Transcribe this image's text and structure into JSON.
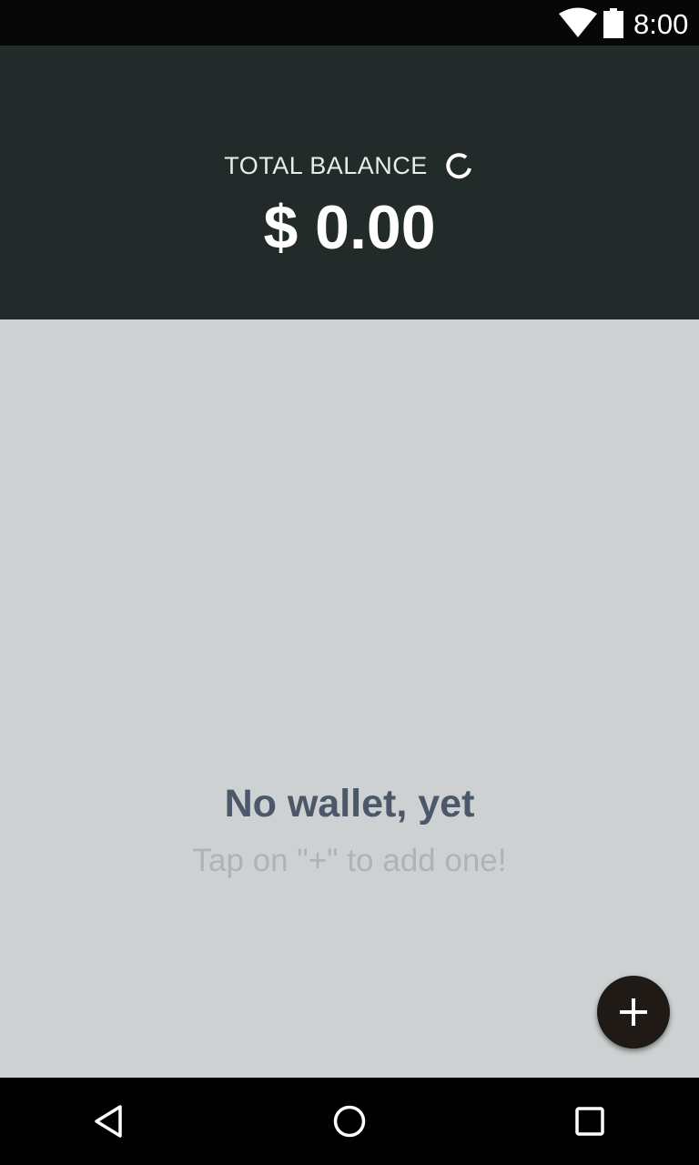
{
  "status_bar": {
    "time": "8:00",
    "wifi_icon": "wifi-icon",
    "battery_icon": "battery-icon"
  },
  "header": {
    "balance_label": "TOTAL BALANCE",
    "refresh_icon": "refresh-icon",
    "balance_amount": "$ 0.00"
  },
  "empty_state": {
    "title": "No wallet, yet",
    "subtitle": "Tap on \"+\" to add one!"
  },
  "fab": {
    "icon": "plus-icon"
  },
  "nav_bar": {
    "back_icon": "back-icon",
    "home_icon": "home-icon",
    "recents_icon": "recents-icon"
  },
  "colors": {
    "header_bg": "#232b2a",
    "content_bg": "#cdd1d2",
    "empty_title": "#4c5869",
    "empty_subtitle": "#aeb4b6",
    "fab_bg": "#1f1a16"
  }
}
